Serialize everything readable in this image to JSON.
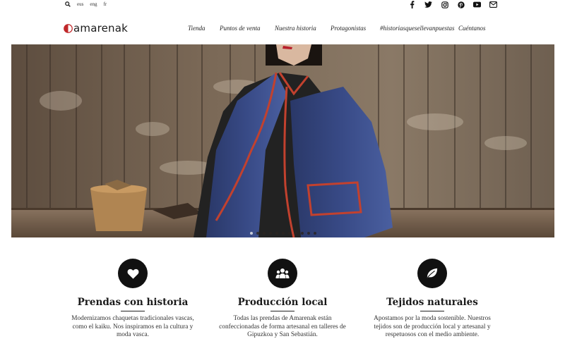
{
  "topbar": {
    "languages": [
      "eus",
      "eng",
      "fr"
    ],
    "social_icons": [
      "facebook-icon",
      "twitter-icon",
      "instagram-icon",
      "pinterest-icon",
      "youtube-icon",
      "mail-icon"
    ]
  },
  "brand": {
    "name": "amarenak"
  },
  "nav": {
    "items": [
      "Tienda",
      "Puntos de venta",
      "Nuestra historia",
      "Protagonistas",
      "#historiasquesellevanpuestas",
      "Cuéntanos"
    ]
  },
  "hero": {
    "slides_count": 11,
    "active_slide": 0
  },
  "features": [
    {
      "icon": "heart-icon",
      "title": "Prendas con historia",
      "text": "Modernizamos chaquetas tradicionales vascas, como el kaiku. Nos inspiramos en la cultura y moda vasca."
    },
    {
      "icon": "people-icon",
      "title": "Producción local",
      "text": "Todas las prendas de Amarenak están confeccionadas de forma artesanal en talleres de Gipuzkoa y San Sebastián."
    },
    {
      "icon": "leaf-icon",
      "title": "Tejidos naturales",
      "text": "Apostamos por la moda sostenible. Nuestros tejidos son de producción local y artesanal y respetuosos con el medio ambiente."
    }
  ],
  "colors": {
    "brand_red": "#c0282a",
    "jacket_blue": "#34447a",
    "wood": "#6e5c4a"
  }
}
